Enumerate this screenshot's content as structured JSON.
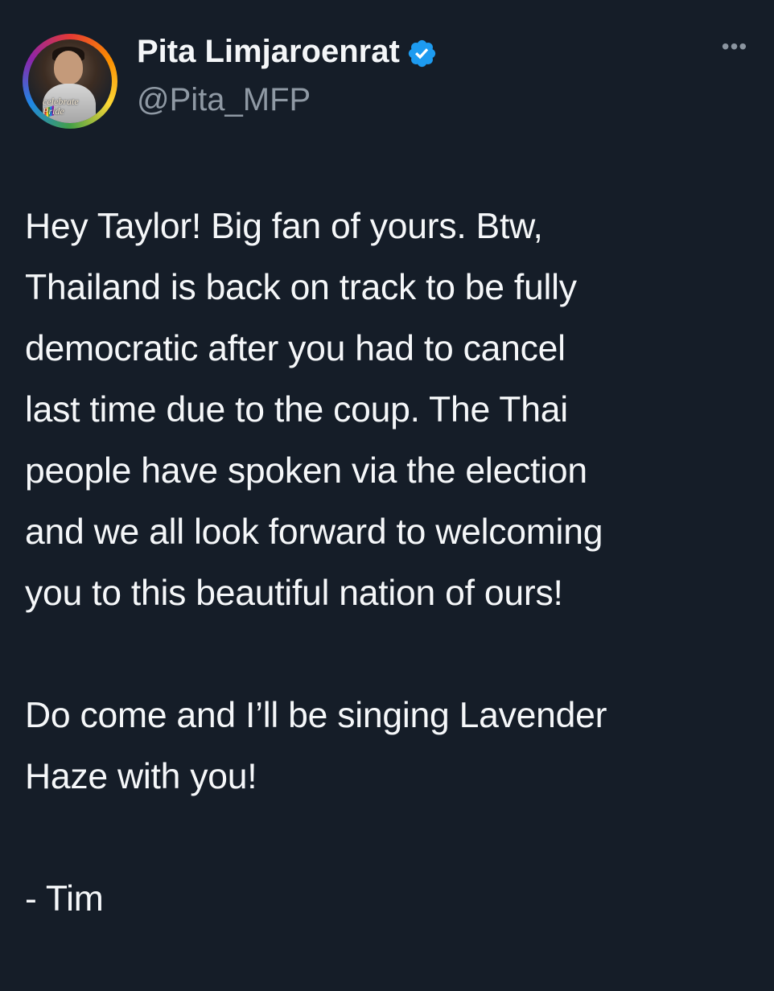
{
  "author": {
    "display_name": "Pita Limjaroenrat",
    "handle": "@Pita_MFP",
    "verified_icon": "verified-badge-icon",
    "avatar_icon": "profile-avatar",
    "avatar_text": [
      "celebrate",
      "Pride"
    ],
    "badge_color": "#1d9bf0"
  },
  "menu": {
    "more_label": "•••",
    "icon": "more-options-icon"
  },
  "tweet": {
    "paragraphs": [
      {
        "lines": [
          "Hey Taylor! Big fan of yours. Btw,",
          "Thailand is back on track to be fully",
          "democratic after you had to cancel",
          "last time due to the coup. The Thai",
          "people have spoken via the election",
          "and we all look forward to welcoming",
          "you to this beautiful nation of ours!"
        ]
      },
      {
        "lines": [
          "Do come and I’ll be singing Lavender",
          "Haze with you!"
        ]
      },
      {
        "lines": [
          "- Tim"
        ]
      }
    ]
  },
  "colors": {
    "background": "#151d28",
    "primary_text": "#f5f7f9",
    "secondary_text": "#8f99a4",
    "verified_blue": "#1d9bf0"
  }
}
